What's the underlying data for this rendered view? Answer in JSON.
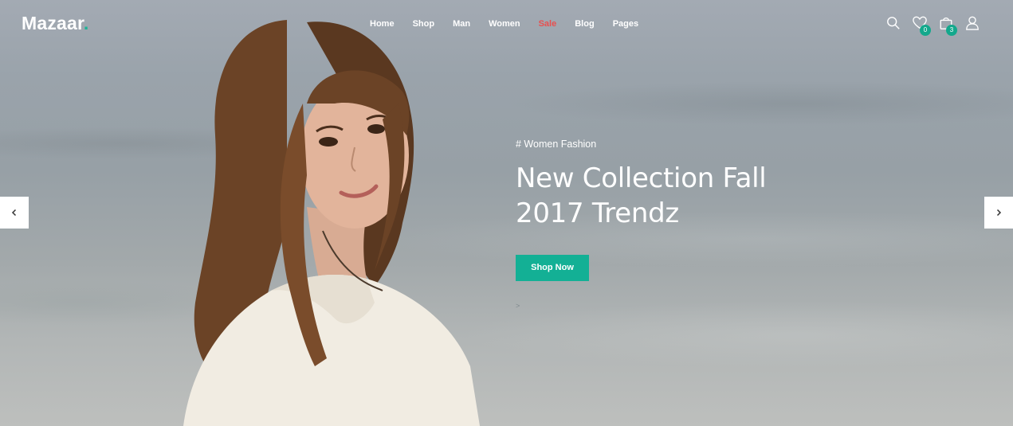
{
  "brand": {
    "name": "Mazaar",
    "dot": ".",
    "accent": "#1bb496"
  },
  "nav": {
    "items": [
      {
        "label": "Home"
      },
      {
        "label": "Shop"
      },
      {
        "label": "Man"
      },
      {
        "label": "Women"
      },
      {
        "label": "Sale",
        "color": "#e8504f"
      },
      {
        "label": "Blog"
      },
      {
        "label": "Pages"
      }
    ]
  },
  "header_icons": {
    "search": "search-icon",
    "wishlist": {
      "icon": "heart-icon",
      "count": "0"
    },
    "cart": {
      "icon": "shopping-bag-icon",
      "count": "3"
    },
    "account": "user-icon"
  },
  "slide": {
    "tag": "# Women Fashion",
    "title_line1": "New Collection Fall",
    "title_line2": "2017 Trendz",
    "cta_label": "Shop Now",
    "small_arrow": ">"
  },
  "slider_controls": {
    "prev": "chevron-left-icon",
    "next": "chevron-right-icon"
  }
}
